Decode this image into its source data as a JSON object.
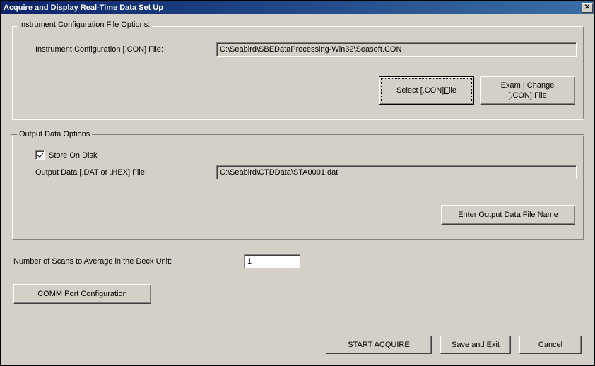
{
  "title": "Acquire and Display Real-Time Data Set Up",
  "group_config": {
    "legend": "Instrument Configuration File Options:",
    "label": "Instrument Configuration [.CON] File:",
    "value": "C:\\Seabird\\SBEDataProcessing-Win32\\Seasoft.CON",
    "select_btn_html": "Select [.CON] <u>F</u>ile",
    "exam_btn_html": "Exam | Change<br>[.CON] File"
  },
  "group_output": {
    "legend": "Output Data Options",
    "store_label": "Store On Disk",
    "store_checked": true,
    "out_label": "Output Data [.DAT or .HEX] File:",
    "out_value": "C:\\Seabird\\CTDData\\STA0001.dat",
    "enter_btn_html": "Enter Output Data File <u>N</u>ame"
  },
  "scans_label": "Number of Scans to Average in the Deck Unit:",
  "scans_value": "1",
  "comm_btn_html": "COMM <u>P</u>ort Configuration",
  "start_btn_html": "<u>S</u>TART ACQUIRE",
  "save_btn_html": "Save and E<u>x</u>it",
  "cancel_btn_html": "<u>C</u>ancel"
}
